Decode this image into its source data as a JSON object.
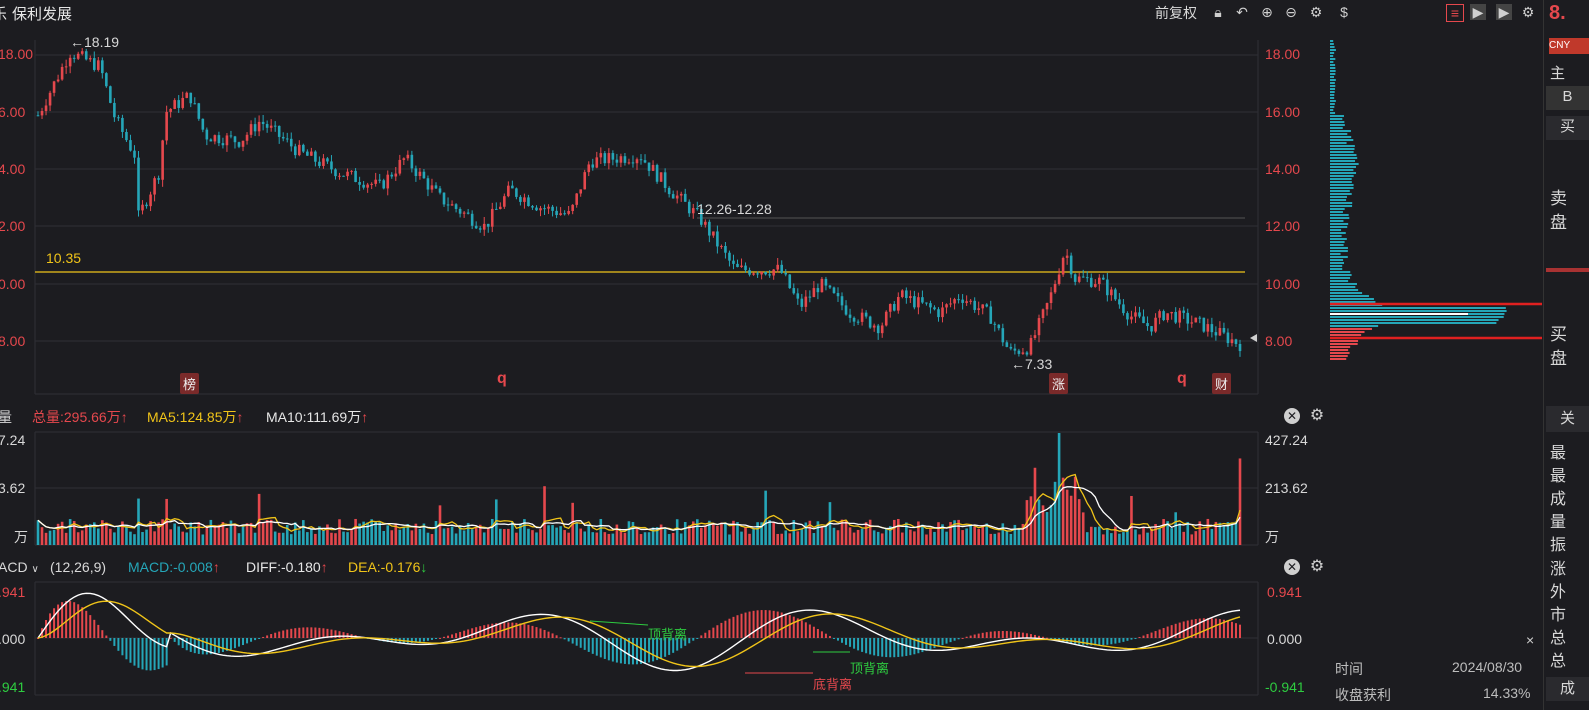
{
  "topbar": {
    "left_fragment": "乐",
    "stock_name": "保利发展",
    "adjust_label": "前复权",
    "price_fragment": "8.",
    "currency_badge": "CNY",
    "icons": [
      "lock-icon",
      "undo-icon",
      "zoom-in-icon",
      "zoom-out-icon",
      "gear-icon",
      "help-icon",
      "list-icon",
      "play-icon",
      "play-icon",
      "gear-icon"
    ]
  },
  "main_chart": {
    "high_label": "←18.19",
    "low_label": "←7.33",
    "range_label": "12.26-12.28",
    "hline_label": "10.35",
    "left_axis": [
      "18.00",
      "6.00",
      "4.00",
      "2.00",
      "0.00",
      "8.00"
    ],
    "right_axis": [
      "18.00",
      "16.00",
      "14.00",
      "12.00",
      "10.00",
      "8.00"
    ],
    "markers": [
      "榜",
      "q",
      "涨",
      "q",
      "财"
    ]
  },
  "volume_panel": {
    "label": "量",
    "total": "总量:295.66万",
    "ma5": "MA5:124.85万",
    "ma10": "MA10:111.69万",
    "left_axis": [
      "7.24",
      "3.62",
      "万"
    ],
    "right_axis": [
      "427.24",
      "213.62",
      "万"
    ]
  },
  "macd_panel": {
    "name": "ACD",
    "params": "(12,26,9)",
    "macd": "MACD:-0.008",
    "diff": "DIFF:-0.180",
    "dea": "DEA:-0.176",
    "left_axis": [
      ".941",
      ".000",
      ".941"
    ],
    "right_axis": [
      "0.941",
      "0.000",
      "-0.941"
    ],
    "divergence_labels": [
      "顶背离",
      "顶背离",
      "底背离"
    ]
  },
  "right_column": {
    "items": [
      "主",
      "B",
      "买",
      "卖",
      "盘",
      "买",
      "盘",
      "关",
      "最",
      "最",
      "成",
      "量",
      "振",
      "涨",
      "外",
      "市",
      "总",
      "总",
      "成"
    ]
  },
  "info_box": {
    "close": "×",
    "time_label": "时间",
    "time_value": "2024/08/30",
    "profit_label": "收盘获利",
    "profit_value": "14.33%"
  },
  "colors": {
    "up": "#e5484d",
    "down": "#25a6b8",
    "ma_yellow": "#f0c419",
    "ma_white": "#ffffff",
    "background": "#1c1c20"
  }
}
